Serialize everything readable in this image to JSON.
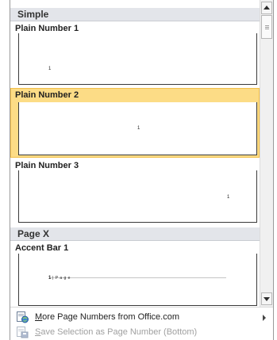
{
  "gallery": {
    "sections": [
      {
        "title": "Simple"
      },
      {
        "title": "Page X"
      }
    ],
    "items": [
      {
        "label": "Plain Number 1",
        "preview_number": "1"
      },
      {
        "label": "Plain Number 2",
        "preview_number": "1",
        "selected": true
      },
      {
        "label": "Plain Number 3",
        "preview_number": "1"
      },
      {
        "label": "Accent Bar 1",
        "preview_number": "1",
        "preview_suffix": "| P a g e"
      }
    ]
  },
  "menu": {
    "more": {
      "mnemonic": "M",
      "rest": "ore Page Numbers from Office.com"
    },
    "save": {
      "mnemonic": "S",
      "rest": "ave Selection as Page Number (Bottom)",
      "enabled": false
    }
  },
  "colors": {
    "selected_fill": "#fcdc86",
    "selected_border": "#f2bf4a",
    "section_header": "#e3e5ea",
    "disabled_text": "#a0a0a0"
  }
}
